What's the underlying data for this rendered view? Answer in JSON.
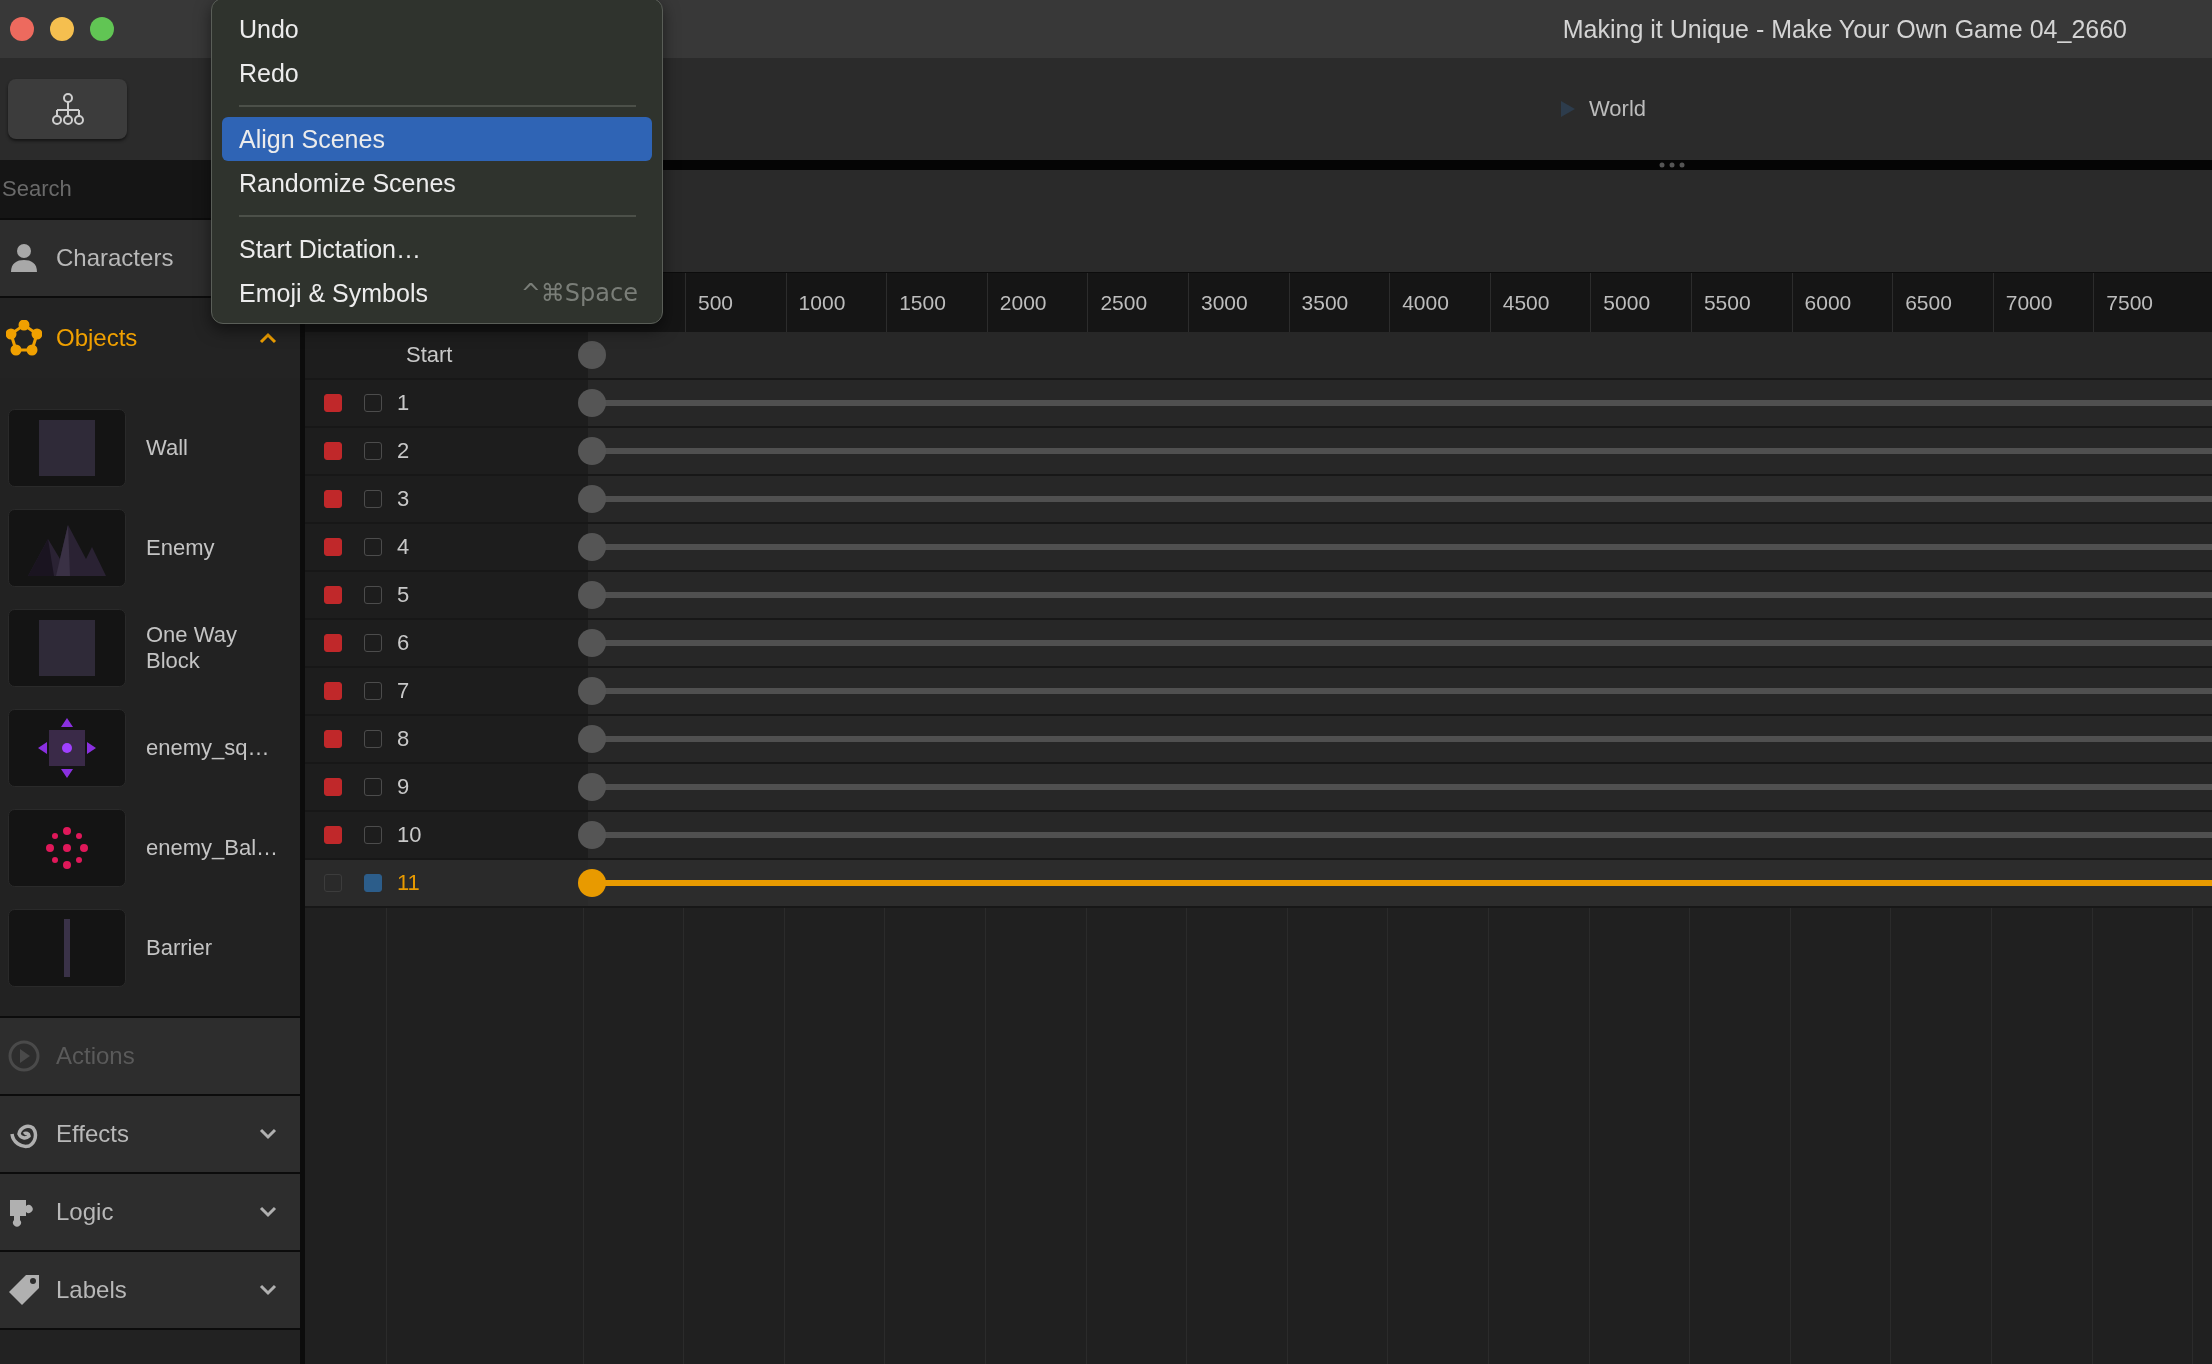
{
  "window": {
    "title": "Making it Unique - Make Your Own Game 04_2660"
  },
  "toolbar": {
    "breadcrumb": "World"
  },
  "context_menu": {
    "items": [
      {
        "kind": "item",
        "label": "Undo",
        "selected": false
      },
      {
        "kind": "item",
        "label": "Redo",
        "selected": false
      },
      {
        "kind": "separator"
      },
      {
        "kind": "item",
        "label": "Align Scenes",
        "selected": true
      },
      {
        "kind": "item",
        "label": "Randomize Scenes",
        "selected": false
      },
      {
        "kind": "separator"
      },
      {
        "kind": "item",
        "label": "Start Dictation…",
        "selected": false
      },
      {
        "kind": "item",
        "label": "Emoji & Symbols",
        "shortcut": "^⌘Space",
        "selected": false
      }
    ]
  },
  "sidebar": {
    "search": {
      "placeholder": "Search"
    },
    "sections": [
      {
        "kind": "characters",
        "label": "Characters",
        "disabled": false
      },
      {
        "kind": "objects",
        "label": "Objects",
        "expanded": true,
        "disabled": false,
        "items": [
          {
            "name": "Wall",
            "kind": "block"
          },
          {
            "name": "Enemy",
            "kind": "mountains"
          },
          {
            "name": "One Way Block",
            "kind": "block"
          },
          {
            "name": "enemy_sq…",
            "kind": "diamond"
          },
          {
            "name": "enemy_Bal…",
            "kind": "ball"
          },
          {
            "name": "Barrier",
            "kind": "bar"
          }
        ]
      },
      {
        "kind": "actions",
        "label": "Actions",
        "disabled": true
      },
      {
        "kind": "effects",
        "label": "Effects",
        "expanded": false,
        "disabled": false
      },
      {
        "kind": "logic",
        "label": "Logic",
        "expanded": false,
        "disabled": false
      },
      {
        "kind": "labels",
        "label": "Labels",
        "expanded": false,
        "disabled": false
      }
    ]
  },
  "timeline": {
    "ruler": [
      "500",
      "1000",
      "1500",
      "2000",
      "2500",
      "3000",
      "3500",
      "4000",
      "4500",
      "5000",
      "5500",
      "6000",
      "6500",
      "7000",
      "7500"
    ],
    "start_label": "Start",
    "scenes": [
      {
        "label": "1",
        "flagged": true,
        "checked": false,
        "selected": false
      },
      {
        "label": "2",
        "flagged": true,
        "checked": false,
        "selected": false
      },
      {
        "label": "3",
        "flagged": true,
        "checked": false,
        "selected": false
      },
      {
        "label": "4",
        "flagged": true,
        "checked": false,
        "selected": false
      },
      {
        "label": "5",
        "flagged": true,
        "checked": false,
        "selected": false
      },
      {
        "label": "6",
        "flagged": true,
        "checked": false,
        "selected": false
      },
      {
        "label": "7",
        "flagged": true,
        "checked": false,
        "selected": false
      },
      {
        "label": "8",
        "flagged": true,
        "checked": false,
        "selected": false
      },
      {
        "label": "9",
        "flagged": true,
        "checked": false,
        "selected": false
      },
      {
        "label": "10",
        "flagged": true,
        "checked": false,
        "selected": false
      },
      {
        "label": "11",
        "flagged": false,
        "checked": true,
        "selected": true
      }
    ]
  }
}
